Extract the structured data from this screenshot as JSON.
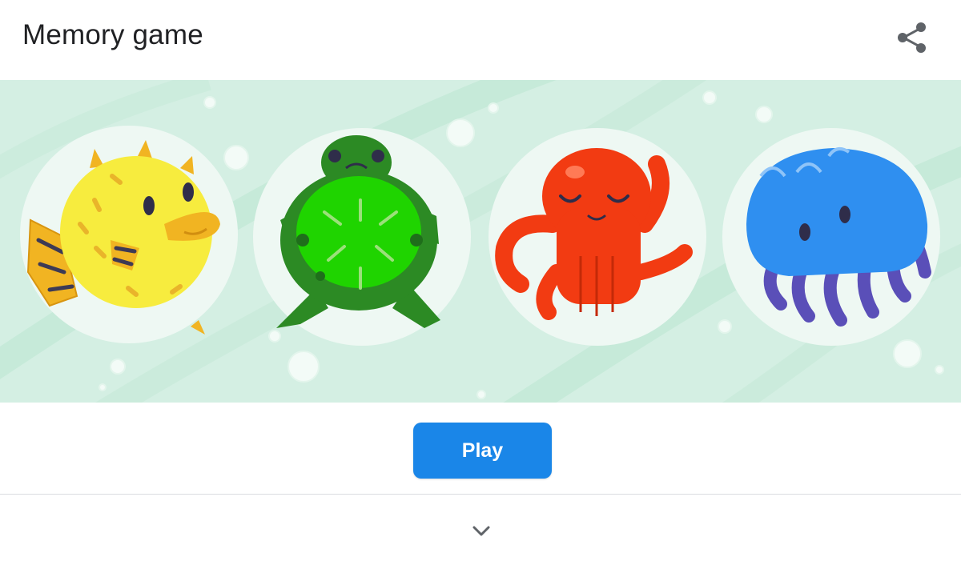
{
  "header": {
    "title": "Memory game",
    "share_icon": "share-icon"
  },
  "banner": {
    "background_color": "#d4efe3",
    "cards": [
      {
        "name": "pufferfish",
        "color": "#f7ec3e"
      },
      {
        "name": "turtle",
        "color": "#1fd400"
      },
      {
        "name": "octopus",
        "color": "#f23b12"
      },
      {
        "name": "jellyfish",
        "color": "#2f8ff0"
      }
    ]
  },
  "play": {
    "label": "Play",
    "color": "#1a86e8"
  },
  "footer": {
    "expand_icon": "chevron-down-icon"
  }
}
